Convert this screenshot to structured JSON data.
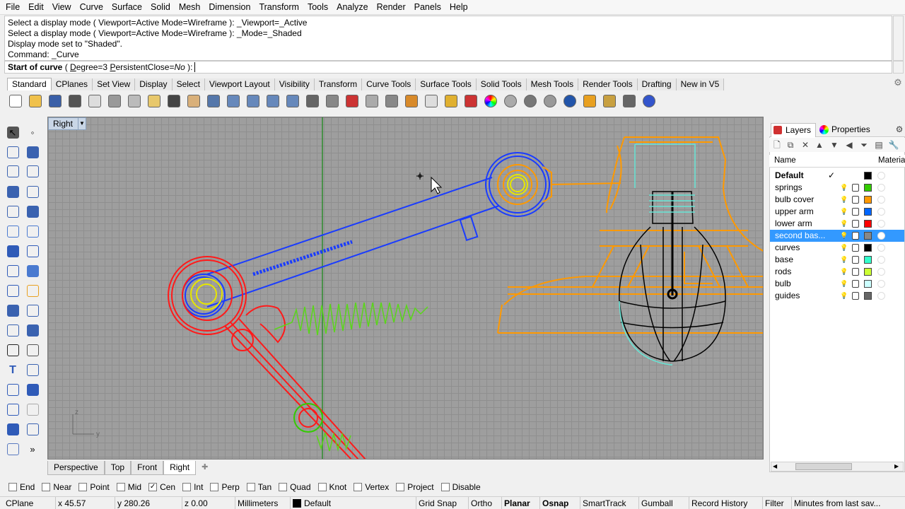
{
  "menubar": [
    "File",
    "Edit",
    "View",
    "Curve",
    "Surface",
    "Solid",
    "Mesh",
    "Dimension",
    "Transform",
    "Tools",
    "Analyze",
    "Render",
    "Panels",
    "Help"
  ],
  "command_history": [
    "Select a display mode ( Viewport=Active  Mode=Wireframe ): _Viewport=_Active",
    "Select a display mode ( Viewport=Active  Mode=Wireframe ): _Mode=_Shaded",
    "Display mode set to \"Shaded\".",
    "Command: _Curve"
  ],
  "command_prompt": {
    "label": "Start of curve",
    "open": "( ",
    "opt1_key": "D",
    "opt1_rest": "egree=3  ",
    "opt2_key": "P",
    "opt2_rest": "ersistentClose=",
    "opt2_value": "No",
    "close": " ):"
  },
  "toolbar_tabs": [
    "Standard",
    "CPlanes",
    "Set View",
    "Display",
    "Select",
    "Viewport Layout",
    "Visibility",
    "Transform",
    "Curve Tools",
    "Surface Tools",
    "Solid Tools",
    "Mesh Tools",
    "Render Tools",
    "Drafting",
    "New in V5"
  ],
  "toolbar_icons": [
    "new-icon",
    "open-icon",
    "save-icon",
    "print-icon",
    "copy-icon",
    "cut-icon",
    "copy-clipboard-icon",
    "paste-icon",
    "undo-icon",
    "pan-icon",
    "move-view-icon",
    "zoom-icon",
    "zoom-window-icon",
    "zoom-extents-icon",
    "zoom-selected-icon",
    "rotate-view-icon",
    "four-viewports-icon",
    "car-icon",
    "transform-icon",
    "camera-icon",
    "snap-icon",
    "light-icon",
    "lock-icon",
    "layer-icon",
    "color-wheel-icon",
    "sphere-wire-icon",
    "sphere-shaded-icon",
    "sphere-render-icon",
    "sphere-blue-icon",
    "spotlight-icon",
    "settings-gear-icon",
    "options-icon",
    "help-icon"
  ],
  "toolbar_colors": [
    "#ffffff",
    "#f0c14b",
    "#3a5fa8",
    "#555555",
    "#dddddd",
    "#999999",
    "#bbbbbb",
    "#e8c86b",
    "#444444",
    "#d9b07a",
    "#5577aa",
    "#6688bb",
    "#6688bb",
    "#6688bb",
    "#6688bb",
    "#666666",
    "#888888",
    "#cc3333",
    "#aaaaaa",
    "#888888",
    "#d88a2a",
    "#dddddd",
    "#e0b030",
    "#cc3333",
    "#ff8800",
    "#aaaaaa",
    "#777777",
    "#999999",
    "#2255aa",
    "#e8a020",
    "#c8a040",
    "#666666",
    "#3355cc"
  ],
  "viewport": {
    "title": "Right",
    "axis_z": "z",
    "axis_y": "y"
  },
  "viewport_tabs": [
    "Perspective",
    "Top",
    "Front",
    "Right"
  ],
  "viewport_tab_active": "Right",
  "panel": {
    "tab_layers": "Layers",
    "tab_properties": "Properties",
    "col_name": "Name",
    "col_material": "Material"
  },
  "layers": [
    {
      "name": "Default",
      "color": "#000000",
      "bold": true,
      "current": "✓"
    },
    {
      "name": "springs",
      "color": "#33cc00"
    },
    {
      "name": "bulb cover",
      "color": "#ff9900"
    },
    {
      "name": "upper arm",
      "color": "#0066ff"
    },
    {
      "name": "lower arm",
      "color": "#ff0000"
    },
    {
      "name": "second bas...",
      "color": "#888888",
      "selected": true
    },
    {
      "name": "curves",
      "color": "#000000"
    },
    {
      "name": "base",
      "color": "#33ffcc"
    },
    {
      "name": "rods",
      "color": "#ccff33"
    },
    {
      "name": "bulb",
      "color": "#ccffff"
    },
    {
      "name": "guides",
      "color": "#666666"
    }
  ],
  "osnaps": [
    {
      "label": "End",
      "checked": false
    },
    {
      "label": "Near",
      "checked": false
    },
    {
      "label": "Point",
      "checked": false
    },
    {
      "label": "Mid",
      "checked": false
    },
    {
      "label": "Cen",
      "checked": true
    },
    {
      "label": "Int",
      "checked": false
    },
    {
      "label": "Perp",
      "checked": false
    },
    {
      "label": "Tan",
      "checked": false
    },
    {
      "label": "Quad",
      "checked": false
    },
    {
      "label": "Knot",
      "checked": false
    },
    {
      "label": "Vertex",
      "checked": false
    },
    {
      "label": "Project",
      "checked": false
    },
    {
      "label": "Disable",
      "checked": false
    }
  ],
  "status": {
    "cplane": "CPlane",
    "x": "x 45.57",
    "y": "y 280.26",
    "z": "z 0.00",
    "units": "Millimeters",
    "layer": "Default",
    "grid_snap": "Grid Snap",
    "ortho": "Ortho",
    "planar": "Planar",
    "osnap": "Osnap",
    "smarttrack": "SmartTrack",
    "gumball": "Gumball",
    "record_history": "Record History",
    "filter": "Filter",
    "autosave": "Minutes from last sav..."
  }
}
